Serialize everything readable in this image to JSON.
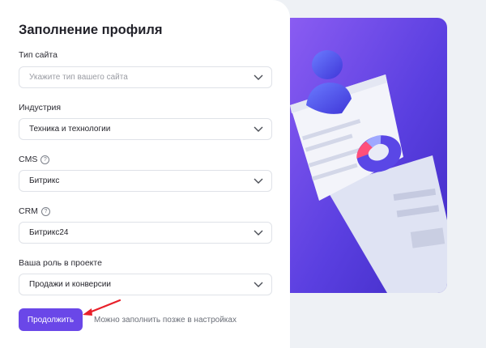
{
  "form": {
    "title": "Заполнение профиля",
    "fields": [
      {
        "label": "Тип сайта",
        "value": "",
        "placeholder": "Укажите тип вашего сайта",
        "has_help": false
      },
      {
        "label": "Индустрия",
        "value": "Техника и технологии",
        "placeholder": "",
        "has_help": false
      },
      {
        "label": "CMS",
        "value": "Битрикс",
        "placeholder": "",
        "has_help": true
      },
      {
        "label": "CRM",
        "value": "Битрикс24",
        "placeholder": "",
        "has_help": true
      },
      {
        "label": "Ваша роль в проекте",
        "value": "Продажи и конверсии",
        "placeholder": "",
        "has_help": false
      }
    ],
    "help_glyph": "?",
    "continue_label": "Продолжить",
    "later_label": "Можно заполнить позже в настройках"
  },
  "colors": {
    "accent": "#6a47e8",
    "annotation_arrow": "#e8202a",
    "illustration_bg": "#5a3fe0"
  },
  "icons": {
    "select_chevron": "chevron-down-icon",
    "help": "question-circle-icon",
    "illustration": "profile-document-icon"
  }
}
